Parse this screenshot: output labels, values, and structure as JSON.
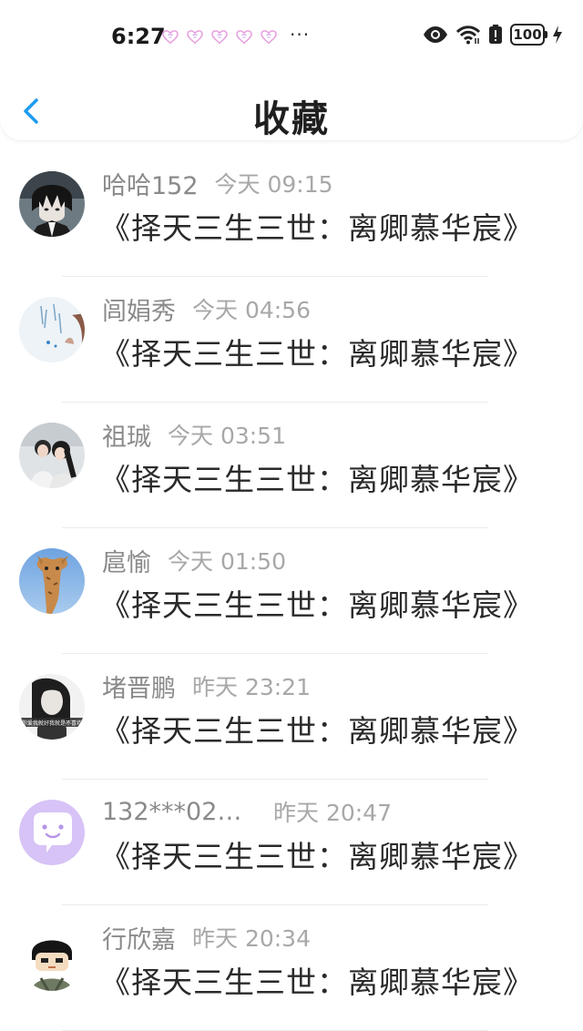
{
  "status_bar": {
    "time": "6:27",
    "more": "···",
    "battery": "100",
    "icons": [
      "heart-icon",
      "eye-icon",
      "wifi-icon",
      "alert-battery-icon",
      "battery-icon",
      "charging-icon"
    ]
  },
  "header": {
    "title": "收藏",
    "back_icon": "chevron-left-icon",
    "accent": "#1e9bf0"
  },
  "favorites": [
    {
      "name": "哈哈152",
      "time": "今天 09:15",
      "book": "《择天三生三世：离卿慕华宸》",
      "avatar": "dark-anime-boy"
    },
    {
      "name": "闾娟秀",
      "time": "今天 04:56",
      "book": "《择天三生三世：离卿慕华宸》",
      "avatar": "pale-handwriting"
    },
    {
      "name": "祖珹",
      "time": "今天 03:51",
      "book": "《择天三生三世：离卿慕华宸》",
      "avatar": "couple-photo"
    },
    {
      "name": "扈愉",
      "time": "今天 01:50",
      "book": "《择天三生三世：离卿慕华宸》",
      "avatar": "giraffe"
    },
    {
      "name": "堵晋鹏",
      "time": "昨天 23:21",
      "book": "《择天三生三世：离卿慕华宸》",
      "avatar": "bw-woman",
      "avatar_text": "你爱我就好我就是不喜欢"
    },
    {
      "name": "132***02…",
      "time": "昨天 20:47",
      "book": "《择天三生三世：离卿慕华宸》",
      "avatar": "purple-chat-bubble"
    },
    {
      "name": "行欣嘉",
      "time": "昨天 20:34",
      "book": "《择天三生三世：离卿慕华宸》",
      "avatar": "cartoon-boy"
    }
  ]
}
